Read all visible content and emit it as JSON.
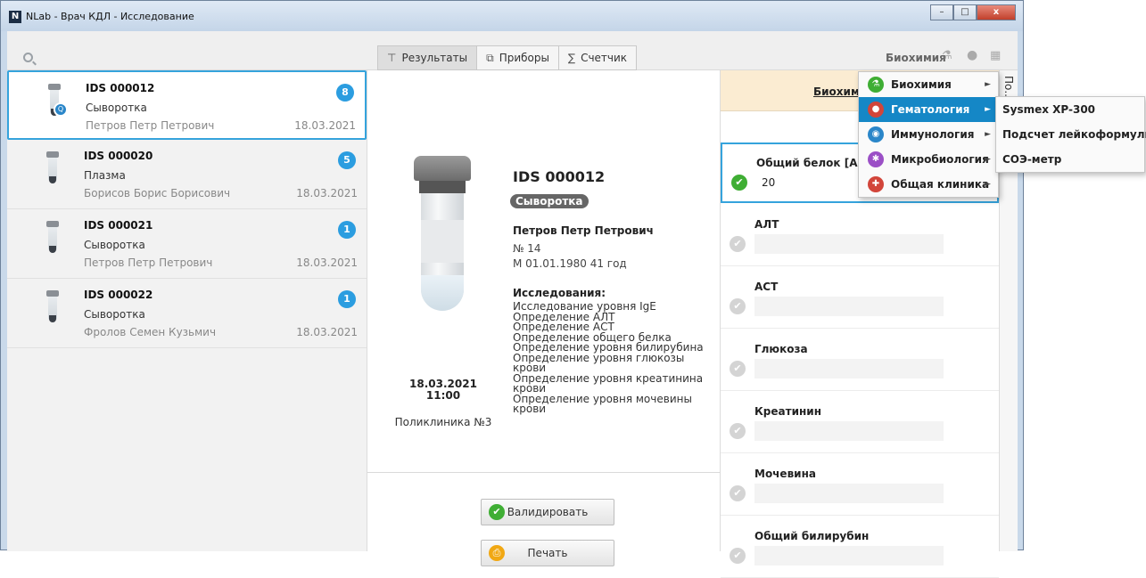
{
  "window": {
    "title": "NLab - Врач КДЛ - Исследование",
    "icon_letter": "N",
    "controls": [
      "–",
      "□",
      "x"
    ]
  },
  "toolbar": {
    "tabs": [
      {
        "label": "Результаты",
        "icon": "tube-icon",
        "glyph": "⊤"
      },
      {
        "label": "Приборы",
        "icon": "devices-icon",
        "glyph": "⧉"
      },
      {
        "label": "Счетчик",
        "icon": "sigma-icon",
        "glyph": "∑"
      }
    ],
    "lab_label": "Биохимия",
    "icons": {
      "flask": "⚗",
      "user": "●",
      "grid": "▦"
    }
  },
  "samples": [
    {
      "id": "IDS 000012",
      "type": "Сыворотка",
      "patient": "Петров Петр Петрович",
      "date": "18.03.2021",
      "count": "8",
      "mini_badge": "Q"
    },
    {
      "id": "IDS 000020",
      "type": "Плазма",
      "patient": "Борисов Борис Борисович",
      "date": "18.03.2021",
      "count": "5"
    },
    {
      "id": "IDS 000021",
      "type": "Сыворотка",
      "patient": "Петров Петр Петрович",
      "date": "18.03.2021",
      "count": "1"
    },
    {
      "id": "IDS 000022",
      "type": "Сыворотка",
      "patient": "Фролов Семен Кузьмич",
      "date": "18.03.2021",
      "count": "1"
    }
  ],
  "detail": {
    "id": "IDS 000012",
    "type": "Сыворотка",
    "patient": "Петров Петр Петрович",
    "number": "№ 14",
    "dob": "М 01.01.1980 41 год",
    "tests_heading": "Исследования:",
    "tests": [
      "Исследование уровня IgE",
      "Определение АЛТ",
      "Определение АСТ",
      "Определение общего белка",
      "Определение уровня билирубина",
      "Определение уровня глюкозы крови",
      "Определение уровня креатинина крови",
      "Определение уровня мочевины крови"
    ],
    "date": "18.03.2021",
    "time": "11:00",
    "clinic": "Поликлиника №3"
  },
  "buttons": {
    "validate": "Валидировать",
    "print": "Печать",
    "validate_glyph": "✔",
    "print_glyph": "⎙"
  },
  "results": {
    "header": "Биохими",
    "side_tab": "По... Динамика",
    "items": [
      {
        "name": "Общий белок [Адм",
        "value": "20",
        "ok": true
      },
      {
        "name": "АЛТ",
        "value": "",
        "ok": false
      },
      {
        "name": "АСТ",
        "value": "",
        "ok": false
      },
      {
        "name": "Глюкоза",
        "value": "",
        "ok": false
      },
      {
        "name": "Креатинин",
        "value": "",
        "ok": false
      },
      {
        "name": "Мочевина",
        "value": "",
        "ok": false
      },
      {
        "name": "Общий билирубин",
        "value": "",
        "ok": false
      }
    ],
    "check_glyph": "✔"
  },
  "menu": {
    "items": [
      {
        "label": "Биохимия",
        "color": "#3fae34",
        "glyph": "⚗"
      },
      {
        "label": "Гематология",
        "color": "#d2453a",
        "glyph": "●"
      },
      {
        "label": "Иммунология",
        "color": "#2a86c9",
        "glyph": "◉"
      },
      {
        "label": "Микробиология",
        "color": "#9b4fc6",
        "glyph": "✱"
      },
      {
        "label": "Общая клиника",
        "color": "#d2453a",
        "glyph": "✚"
      }
    ],
    "active_index": 1,
    "arrow": "►",
    "submenu": [
      "Sysmex XP-300",
      "Подсчет лейкоформулы",
      "СОЭ-метр"
    ]
  }
}
